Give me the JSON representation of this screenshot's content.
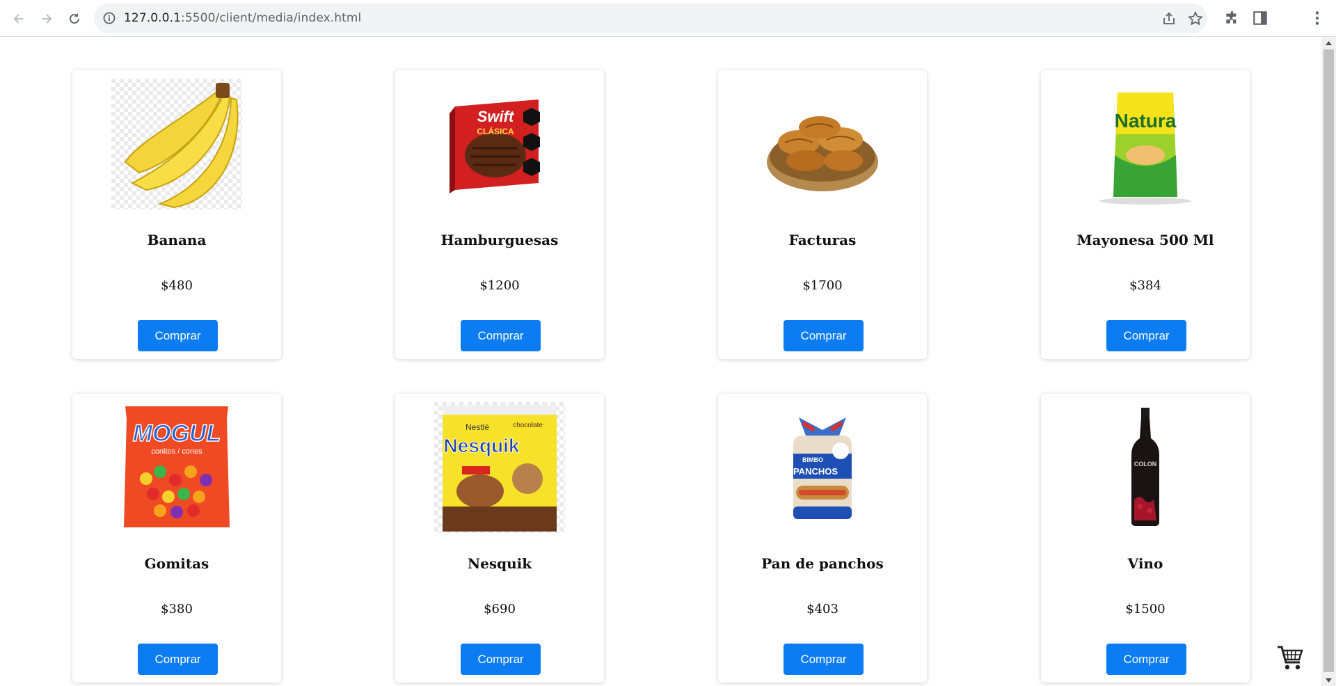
{
  "browser": {
    "url_host": "127.0.0.1",
    "url_rest": ":5500/client/media/index.html"
  },
  "products": [
    {
      "name": "Banana",
      "price": "$480",
      "button": "Comprar",
      "image": "banana"
    },
    {
      "name": "Hamburguesas",
      "price": "$1200",
      "button": "Comprar",
      "image": "hamburguesas"
    },
    {
      "name": "Facturas",
      "price": "$1700",
      "button": "Comprar",
      "image": "facturas"
    },
    {
      "name": "Mayonesa 500 Ml",
      "price": "$384",
      "button": "Comprar",
      "image": "mayonesa"
    },
    {
      "name": "Gomitas",
      "price": "$380",
      "button": "Comprar",
      "image": "gomitas"
    },
    {
      "name": "Nesquik",
      "price": "$690",
      "button": "Comprar",
      "image": "nesquik"
    },
    {
      "name": "Pan de panchos",
      "price": "$403",
      "button": "Comprar",
      "image": "pan-panchos"
    },
    {
      "name": "Vino",
      "price": "$1500",
      "button": "Comprar",
      "image": "vino"
    }
  ],
  "product_image_text": {
    "hamburguesas": [
      "Swift",
      "CLÁSICA"
    ],
    "mayonesa": [
      "Natura"
    ],
    "gomitas": [
      "MOGUL",
      "conitos / cones"
    ],
    "nesquik": [
      "Nestlé",
      "Nesquik",
      "chocolate"
    ],
    "pan-panchos": [
      "BIMBO",
      "PANCHOS"
    ],
    "vino": [
      "COLON"
    ]
  },
  "colors": {
    "accent": "#0b7cf2",
    "button_text": "#ffffff"
  },
  "icons": {
    "cart": "shopping-cart-icon"
  }
}
